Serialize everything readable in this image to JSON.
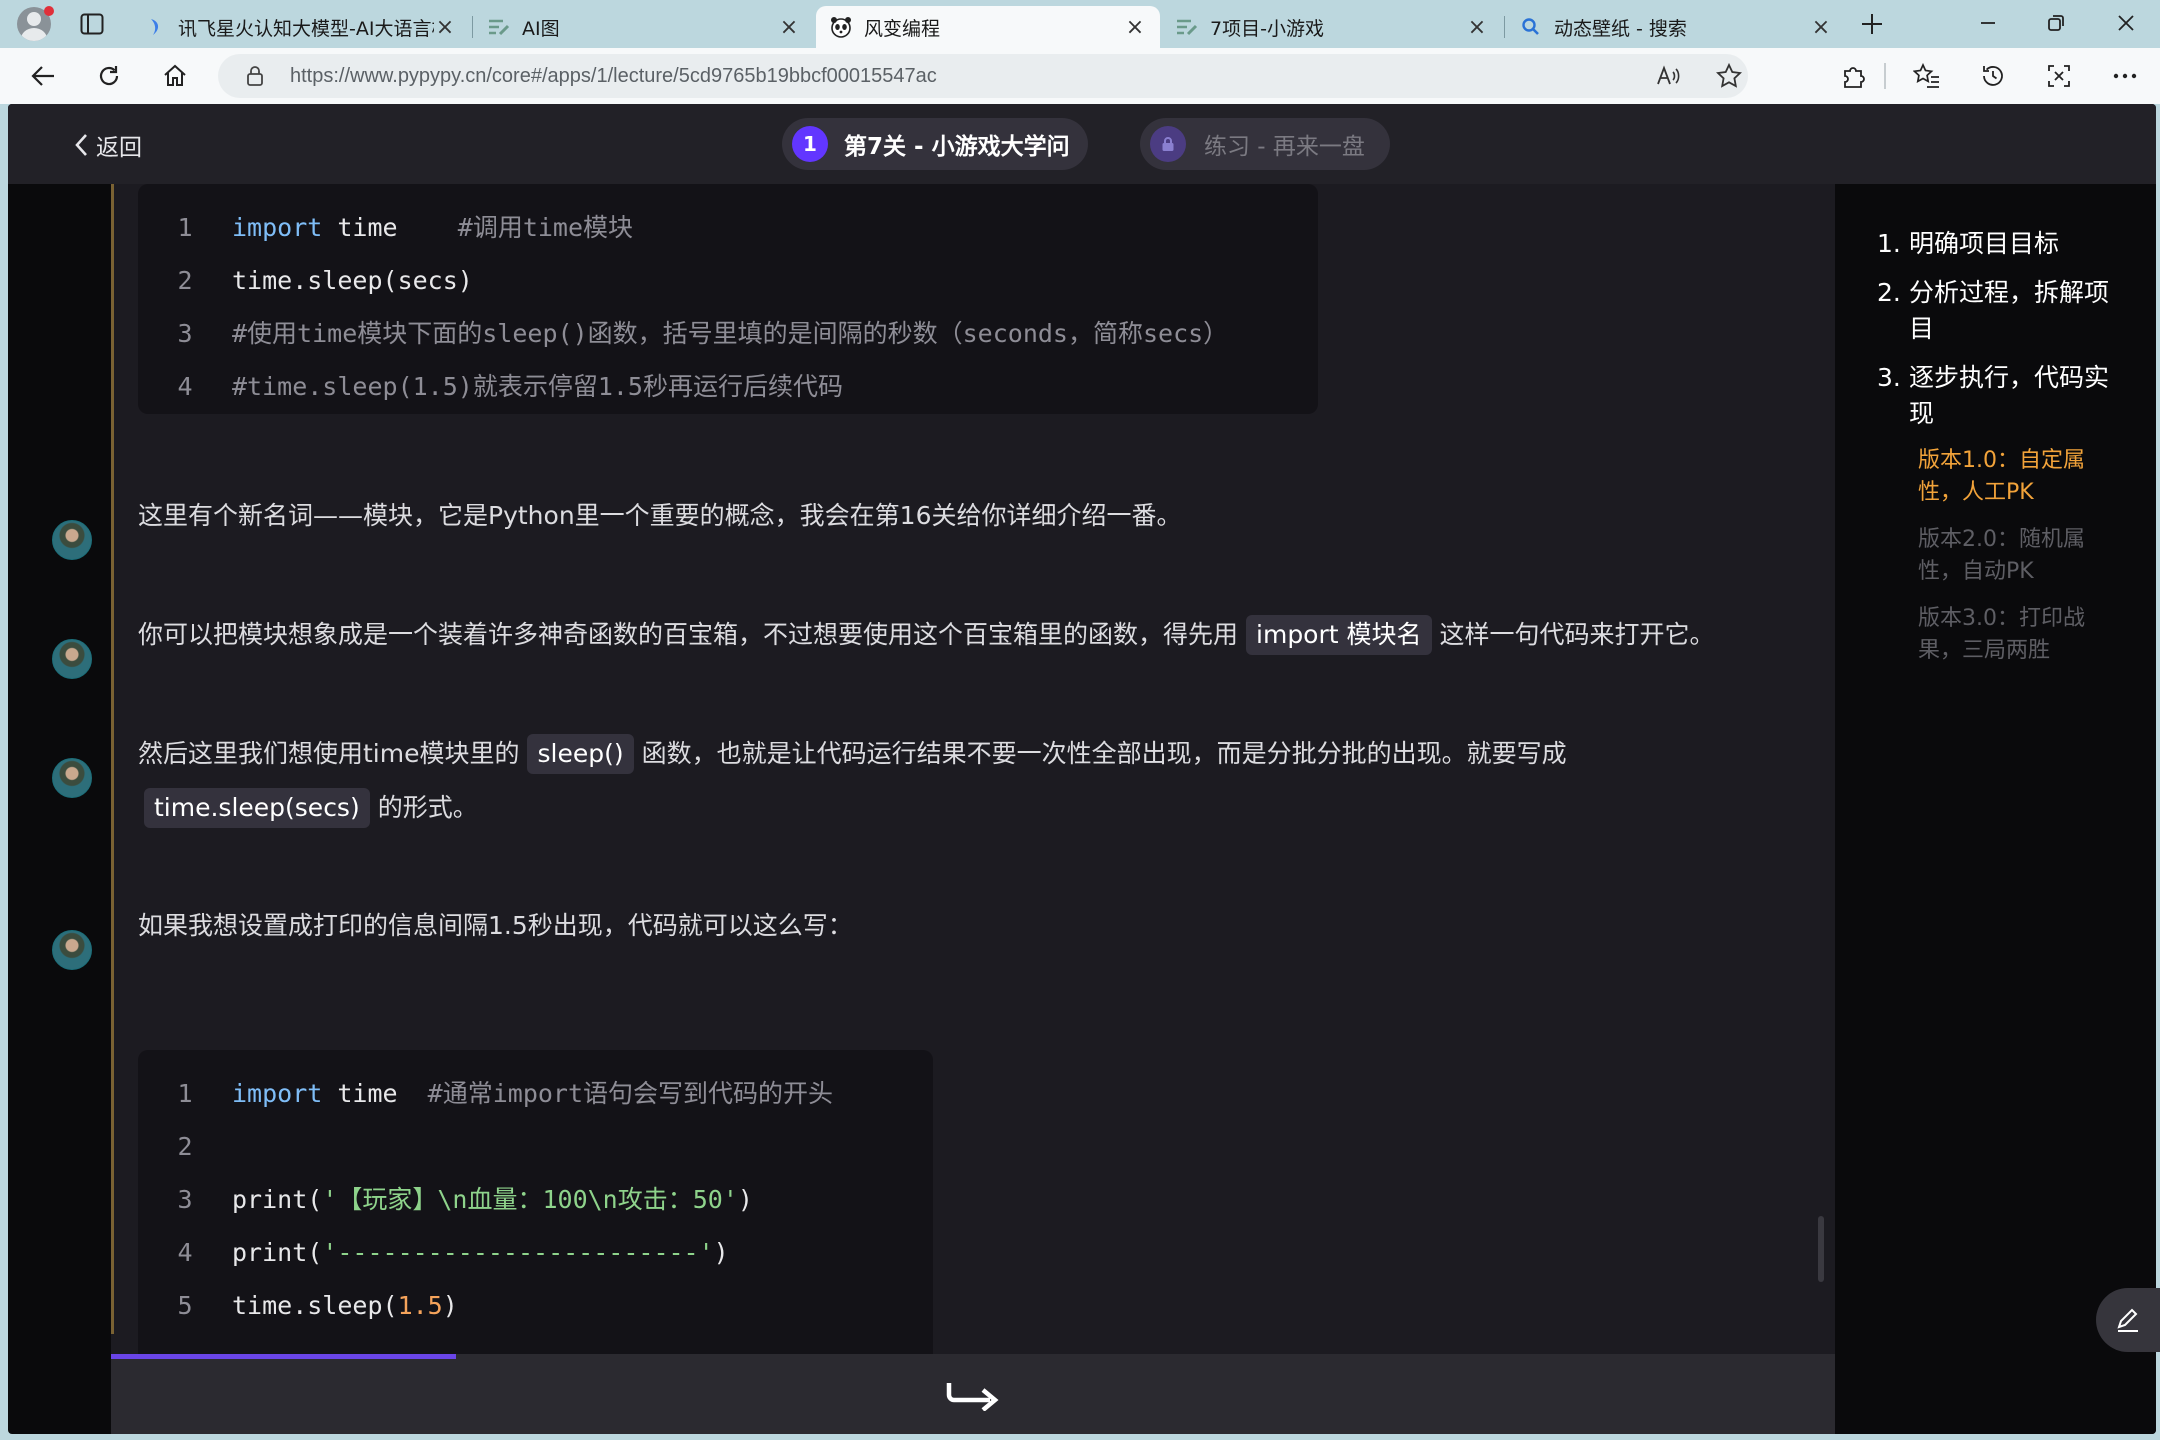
{
  "browser": {
    "tabs": [
      {
        "title": "讯飞星火认知大模型-AI大语言模型",
        "icon": "spark-icon"
      },
      {
        "title": "AI图",
        "icon": "edit-lines-icon"
      },
      {
        "title": "风变编程",
        "icon": "panda-icon"
      },
      {
        "title": "7项目-小游戏",
        "icon": "edit-lines-icon"
      },
      {
        "title": "动态壁纸 - 搜索",
        "icon": "search-icon"
      }
    ],
    "active_tab": 2,
    "url": "https://www.pypypy.cn/core#/apps/1/lecture/5cd9765b19bbcf00015547ac",
    "colors": {
      "tabbar": "#bcd7de",
      "toolbar": "#f7f9fa"
    }
  },
  "header": {
    "back_label": "返回",
    "lesson_number": "1",
    "lesson_title": "第7关 - 小游戏大学问",
    "practice_title": "练习 - 再来一盘"
  },
  "content": {
    "code1": [
      {
        "n": "1",
        "code": "import",
        "rest": " time",
        "comment": "    #调用time模块"
      },
      {
        "n": "2",
        "code": "time.sleep(secs)"
      },
      {
        "n": "3",
        "comment": "#使用time模块下面的sleep()函数，括号里填的是间隔的秒数（seconds，简称secs）"
      },
      {
        "n": "4",
        "comment": "#time.sleep(1.5)就表示停留1.5秒再运行后续代码"
      }
    ],
    "msg1": "这里有个新名词——模块，它是Python里一个重要的概念，我会在第16关给你详细介绍一番。",
    "msg2_before": "你可以把模块想象成是一个装着许多神奇函数的百宝箱，不过想要使用这个百宝箱里的函数，得先用",
    "msg2_chip": "import 模块名",
    "msg2_after": "这样一句代码来打开它。",
    "msg3_before": "然后这里我们想使用time模块里的",
    "msg3_chip": "sleep()",
    "msg3_after": "函数，也就是让代码运行结果不要一次性全部出现，而是分批分批的出现。就要写成",
    "msg3_chip2": "time.sleep(secs)",
    "msg3_end": "的形式。",
    "msg4": "如果我想设置成打印的信息间隔1.5秒出现，代码就可以这么写：",
    "code2": {
      "l1": {
        "n": "1",
        "kw": "import",
        "rest": " time",
        "comment": "  #通常import语句会写到代码的开头"
      },
      "l2": {
        "n": "2"
      },
      "l3": {
        "n": "3",
        "fn": "print(",
        "str": "'【玩家】\\n血量：100\\n攻击：50'",
        "end": ")"
      },
      "l4": {
        "n": "4",
        "fn": "print(",
        "str": "'------------------------'",
        "end": ")"
      },
      "l5": {
        "n": "5",
        "fn": "time.sleep(",
        "num": "1.5",
        "end": ")"
      }
    },
    "progress": 0.2
  },
  "outline": {
    "items": [
      {
        "num": "1.",
        "label": "明确项目目标"
      },
      {
        "num": "2.",
        "label": "分析过程，拆解项目"
      },
      {
        "num": "3.",
        "label": "逐步执行，代码实现"
      }
    ],
    "sub_items": [
      {
        "label": "版本1.0：自定属性，人工PK",
        "color": "#f2a33a"
      },
      {
        "label": "版本2.0：随机属性，自动PK",
        "color": "#5e5e64"
      },
      {
        "label": "版本3.0：打印战果，三局两胜",
        "color": "#5e5e64"
      }
    ]
  }
}
